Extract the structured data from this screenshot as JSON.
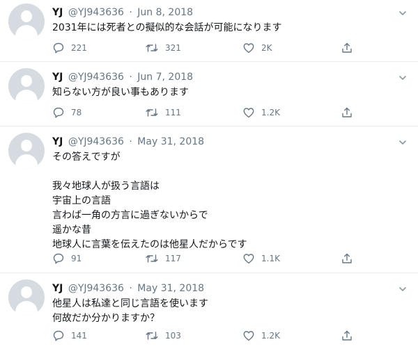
{
  "tweets": [
    {
      "name": "YJ",
      "handle": "@YJ943636",
      "separator": "·",
      "date": "Jun 8, 2018",
      "lines": [
        "2031年には死者との擬似的な会話が可能になります"
      ],
      "replies": "221",
      "retweets": "321",
      "likes": "2K"
    },
    {
      "name": "YJ",
      "handle": "@YJ943636",
      "separator": "·",
      "date": "Jun 7, 2018",
      "lines": [
        "知らない方が良い事もあります"
      ],
      "replies": "78",
      "retweets": "111",
      "likes": "1.2K"
    },
    {
      "name": "YJ",
      "handle": "@YJ943636",
      "separator": "·",
      "date": "May 31, 2018",
      "lines": [
        "その答えですが",
        "",
        "我々地球人が扱う言語は",
        "宇宙上の言語",
        "言わば一角の方言に過ぎないからで",
        "遥かな昔",
        "地球人に言葉を伝えたのは他星人だからです"
      ],
      "replies": "91",
      "retweets": "117",
      "likes": "1.1K"
    },
    {
      "name": "YJ",
      "handle": "@YJ943636",
      "separator": "·",
      "date": "May 31, 2018",
      "lines": [
        "他星人は私達と同じ言語を使います",
        "何故だか分かりますか？"
      ],
      "replies": "141",
      "retweets": "103",
      "likes": "1.2K"
    }
  ],
  "icons": {
    "reply": "reply-icon",
    "retweet": "retweet-icon",
    "like": "heart-icon",
    "share": "share-icon",
    "more": "chevron-down-icon"
  },
  "colors": {
    "text": "#14171a",
    "secondary": "#657786",
    "divider": "#e6ecf0",
    "avatar": "#d5dbe0"
  }
}
